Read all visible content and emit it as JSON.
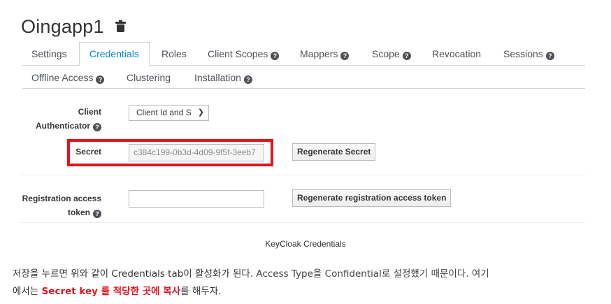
{
  "header": {
    "title": "Oingapp1",
    "delete_icon": "trash-icon"
  },
  "tabs": {
    "row1": [
      {
        "label": "Settings",
        "help": false
      },
      {
        "label": "Credentials",
        "help": false,
        "active": true
      },
      {
        "label": "Roles",
        "help": false
      },
      {
        "label": "Client Scopes",
        "help": true
      },
      {
        "label": "Mappers",
        "help": true
      },
      {
        "label": "Scope",
        "help": true
      },
      {
        "label": "Revocation",
        "help": false
      },
      {
        "label": "Sessions",
        "help": true
      }
    ],
    "row2": [
      {
        "label": "Offline Access",
        "help": true
      },
      {
        "label": "Clustering",
        "help": false
      },
      {
        "label": "Installation",
        "help": true
      }
    ]
  },
  "form": {
    "client_authenticator_label_1": "Client",
    "client_authenticator_label_2": "Authenticator",
    "client_authenticator_value": "Client Id and S",
    "secret_label": "Secret",
    "secret_value": "c384c199-0b3d-4d09-9f5f-3eeb7",
    "regenerate_secret_label": "Regenerate Secret",
    "registration_label_1": "Registration access",
    "registration_label_2": "token",
    "registration_value": "",
    "regenerate_token_label": "Regenerate registration access token"
  },
  "caption": "KeyCloak Credentials",
  "paragraph": {
    "p1": "저장을 누르면 위와 같이 Credentials tab이 활성화가 된다.",
    "p2": " Access Type을 Confidential로 설정했기 때문이다. 여기",
    "p3": "에서는 ",
    "p4": "Secret key 를 적당한 곳에 복사",
    "p5": "를 해두자."
  },
  "colors": {
    "accent": "#0088ce",
    "highlight": "#e3141d"
  }
}
